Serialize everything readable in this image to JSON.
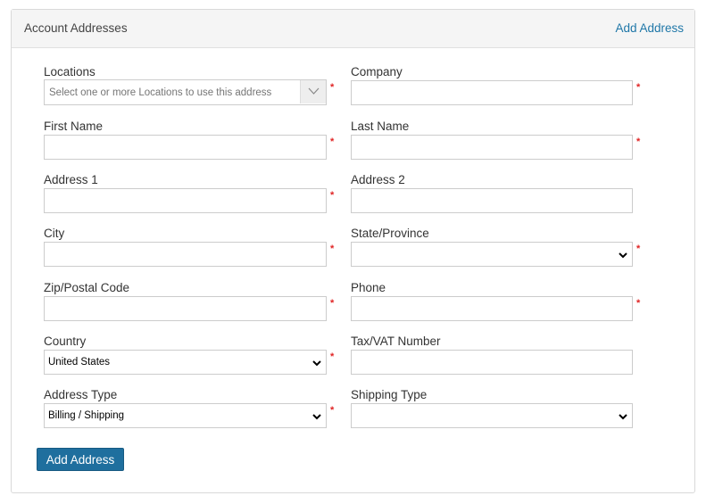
{
  "header": {
    "title": "Account Addresses",
    "add_link": "Add Address"
  },
  "fields": {
    "locations": {
      "label": "Locations",
      "placeholder": "Select one or more Locations to use this address",
      "required": true
    },
    "company": {
      "label": "Company",
      "value": "",
      "required": true
    },
    "first_name": {
      "label": "First Name",
      "value": "",
      "required": true
    },
    "last_name": {
      "label": "Last Name",
      "value": "",
      "required": true
    },
    "address1": {
      "label": "Address 1",
      "value": "",
      "required": true
    },
    "address2": {
      "label": "Address 2",
      "value": "",
      "required": false
    },
    "city": {
      "label": "City",
      "value": "",
      "required": true
    },
    "state": {
      "label": "State/Province",
      "selected": "",
      "required": true
    },
    "zip": {
      "label": "Zip/Postal Code",
      "value": "",
      "required": true
    },
    "phone": {
      "label": "Phone",
      "value": "",
      "required": true
    },
    "country": {
      "label": "Country",
      "selected": "United States",
      "required": true
    },
    "tax": {
      "label": "Tax/VAT Number",
      "value": "",
      "required": false
    },
    "address_type": {
      "label": "Address Type",
      "selected": "Billing / Shipping",
      "required": true
    },
    "shipping_type": {
      "label": "Shipping Type",
      "selected": "",
      "required": false
    }
  },
  "required_marker": "*",
  "submit": {
    "label": "Add Address"
  },
  "colors": {
    "accent": "#1f6f9e",
    "link": "#1f77a8",
    "required": "#e02424",
    "header_bg": "#f5f5f5"
  },
  "icons": {
    "locations_toggle": "chevron-down-thin-icon",
    "select_arrow": "chevron-down-icon"
  }
}
